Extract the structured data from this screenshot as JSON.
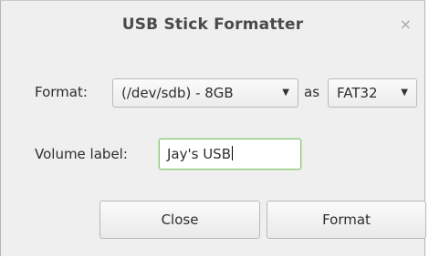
{
  "window": {
    "title": "USB Stick Formatter",
    "close_glyph": "×"
  },
  "format_row": {
    "label": "Format:",
    "device_value": "(/dev/sdb) - 8GB",
    "as_label": "as",
    "filesystem_value": "FAT32",
    "dropdown_glyph": "▼"
  },
  "volume_row": {
    "label": "Volume label:",
    "value": "Jay's USB"
  },
  "buttons": {
    "close_label": "Close",
    "format_label": "Format"
  },
  "colors": {
    "window_bg": "#efefef",
    "focus_border": "#8ec47a"
  }
}
